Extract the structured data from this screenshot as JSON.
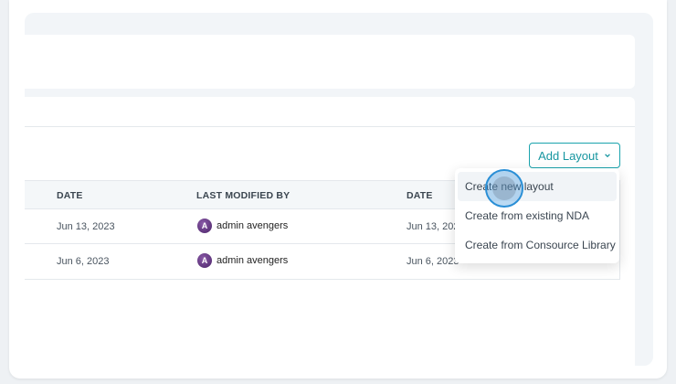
{
  "toolbar": {
    "add_layout_label": "Add Layout",
    "add_layout_icon": "chevron-down-icon"
  },
  "table": {
    "columns": [
      "DATE",
      "LAST MODIFIED BY",
      "DATE"
    ],
    "rows": [
      {
        "date": "Jun 13, 2023",
        "modified_by": "admin avengers",
        "modified_date": "Jun 13, 2023"
      },
      {
        "date": "Jun 6, 2023",
        "modified_by": "admin avengers",
        "modified_date": "Jun 6, 2023"
      }
    ]
  },
  "dropdown": {
    "items": [
      "Create new layout",
      "Create from existing NDA",
      "Create from Consource Library"
    ]
  },
  "colors": {
    "accent": "#1aa3ad",
    "avatar": "#5b2d7a"
  }
}
